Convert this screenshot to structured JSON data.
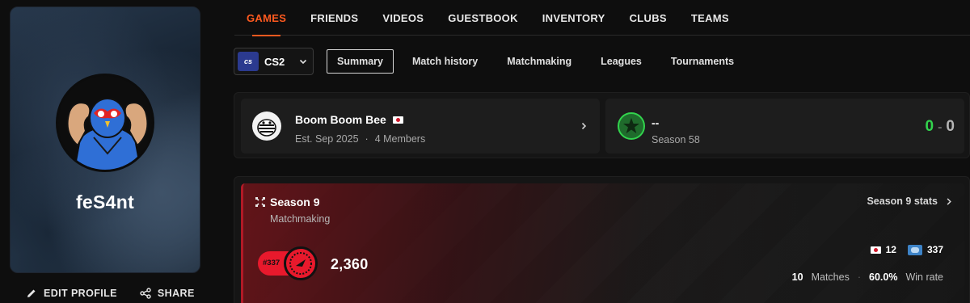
{
  "profile": {
    "username": "feS4nt",
    "edit_label": "EDIT PROFILE",
    "share_label": "SHARE"
  },
  "nav": {
    "tabs": [
      {
        "label": "GAMES",
        "active": true
      },
      {
        "label": "FRIENDS"
      },
      {
        "label": "VIDEOS"
      },
      {
        "label": "GUESTBOOK"
      },
      {
        "label": "INVENTORY"
      },
      {
        "label": "CLUBS"
      },
      {
        "label": "TEAMS"
      }
    ]
  },
  "game_selector": {
    "logo_text": "cs",
    "game": "CS2"
  },
  "subtabs": [
    {
      "label": "Summary",
      "active": true
    },
    {
      "label": "Match history"
    },
    {
      "label": "Matchmaking"
    },
    {
      "label": "Leagues"
    },
    {
      "label": "Tournaments"
    }
  ],
  "club": {
    "name": "Boom Boom Bee",
    "established": "Est. Sep 2025",
    "separator": "·",
    "members": "4 Members",
    "flag": "japan-flag"
  },
  "league": {
    "name": "--",
    "season": "Season 58",
    "wins": "0",
    "score_sep": "-",
    "losses": "0",
    "accent": "#32d34d"
  },
  "season": {
    "title": "Season 9",
    "subtitle": "Matchmaking",
    "stats_link": "Season 9 stats",
    "rank_badge": "#337",
    "elo": "2,360",
    "country_rank": "12",
    "region_rank": "337",
    "matches_value": "10",
    "matches_label": "Matches",
    "separator": "·",
    "winrate_value": "60.0%",
    "winrate_label": "Win rate",
    "accent": "#e8192c"
  },
  "colors": {
    "brand": "#ff5a1f",
    "background": "#0e0e0e"
  }
}
